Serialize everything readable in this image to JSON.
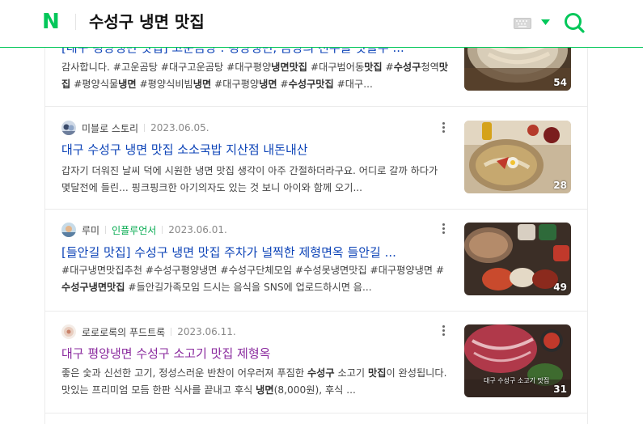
{
  "header": {
    "logo": "N",
    "query": "수성구 냉면 맛집"
  },
  "results": [
    {
      "title": "[대구 평양냉면 맛집] 고운곰탕 : 평양냉면, 곰탕의 진수를 맛볼수 ...",
      "desc_segments": [
        {
          "t": "감사합니다. #고운곰탕 #대구고운곰탕 #대구평양",
          "b": false
        },
        {
          "t": "냉면맛집",
          "b": true
        },
        {
          "t": " #대구범어동",
          "b": false
        },
        {
          "t": "맛집",
          "b": true
        },
        {
          "t": " #",
          "b": false
        },
        {
          "t": "수성구",
          "b": true
        },
        {
          "t": "청역",
          "b": false
        },
        {
          "t": "맛집",
          "b": true
        },
        {
          "t": " #평양식물",
          "b": false
        },
        {
          "t": "냉면",
          "b": true
        },
        {
          "t": " #평양식비빔",
          "b": false
        },
        {
          "t": "냉면",
          "b": true
        },
        {
          "t": " #대구평양",
          "b": false
        },
        {
          "t": "냉면",
          "b": true
        },
        {
          "t": " #",
          "b": false
        },
        {
          "t": "수성구맛집",
          "b": true
        },
        {
          "t": " #대구...",
          "b": false
        }
      ],
      "count": "54"
    },
    {
      "author": "미블로 스토리",
      "badge": "",
      "date": "2023.06.05.",
      "title": "대구 수성구 냉면 맛집 소소국밥 지산점 내돈내산",
      "desc_segments": [
        {
          "t": "갑자기 더워진 날씨 덕에 시원한 냉면 맛집 생각이 아주 간절하더라구요. 어디로 갈까 하다가 몇달전에 들린... 핑크핑크한 아기의자도 있는 것 보니 아이와 함께 오기...",
          "b": false
        }
      ],
      "count": "28"
    },
    {
      "author": "루미",
      "badge": "인플루언서",
      "date": "2023.06.01.",
      "title": "[들안길 맛집] 수성구 냉면 맛집 주차가 널찍한 제형면옥 들안길 ...",
      "desc_segments": [
        {
          "t": "#대구냉면맛집추천 #수성구평양냉면 #수성구단체모임 #수성못냉면맛집 #대구평양냉면 #",
          "b": false
        },
        {
          "t": "수성구냉면맛집",
          "b": true
        },
        {
          "t": " #들안길가족모임 드시는 음식을 SNS에 업로드하시면 음...",
          "b": false
        }
      ],
      "count": "49"
    },
    {
      "author": "로로로록의 푸드트록",
      "badge": "",
      "date": "2023.06.11.",
      "title": "대구 평양냉면 수성구 소고기 맛집 제형옥",
      "desc_segments": [
        {
          "t": "좋은 숯과 신선한 고기, 정성스러운 반찬이 어우러져 푸짐한 ",
          "b": false
        },
        {
          "t": "수성구",
          "b": true
        },
        {
          "t": " 소고기 ",
          "b": false
        },
        {
          "t": "맛집",
          "b": true
        },
        {
          "t": "이 완성됩니다. 맛있는 프리미엄 모듬 한판 식사를 끝내고 후식 ",
          "b": false
        },
        {
          "t": "냉면",
          "b": true
        },
        {
          "t": "(8,000원), 후식 ...",
          "b": false
        }
      ],
      "count": "31",
      "thumb_caption": "대구 수성구 소고기 맛집"
    }
  ]
}
